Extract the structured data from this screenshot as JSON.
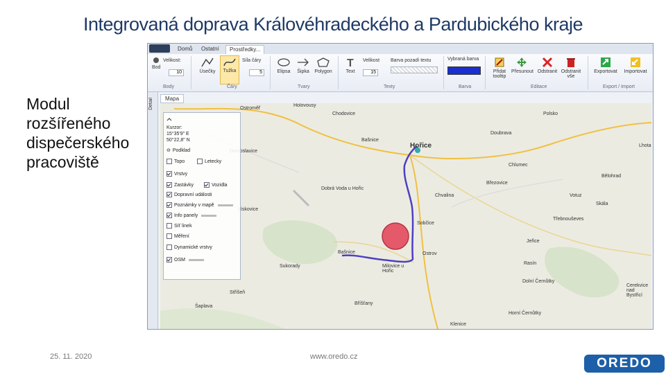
{
  "slide": {
    "title": "Integrovaná doprava Královéhradeckého a Pardubického kraje",
    "side_text": "Modul rozšířeného dispečerského pracoviště",
    "date": "25. 11. 2020",
    "url": "www.oredo.cz",
    "logo": "OREDO"
  },
  "app": {
    "tabs": [
      "Domů",
      "Ostatní",
      "Prostředky..."
    ],
    "ribbon": {
      "buttons": {
        "bod": "Bod",
        "velikost": "Velikost:",
        "usecky": "Úsečky",
        "tuzka": "Tužka",
        "sila_cary": "Síla čáry",
        "elipsa": "Elipsa",
        "sipka": "Šipka",
        "polygon": "Polygon",
        "text": "Text",
        "velikost2": "Velikost",
        "barva_pozadi": "Barva pozadí textu",
        "vybrana_barva": "Vybraná barva",
        "pridat_tooltip": "Přidat tooltip",
        "presunout": "Přesunout",
        "odstranit": "Odstranit",
        "odstranit_vse": "Odstranit vše",
        "exportovat": "Exportovat",
        "importovat": "Importovat"
      },
      "values": {
        "bod_size": "10",
        "sila": "5",
        "text_size": "15"
      },
      "groups": {
        "body": "Body",
        "cary": "Čáry",
        "tvary": "Tvary",
        "texty": "Texty",
        "barva": "Barva",
        "editace": "Editace",
        "export": "Export / Import"
      },
      "colors": {
        "accent": "#1a2fd0"
      }
    },
    "detail_tab": "Detail",
    "map_tab": "Mapa",
    "panel": {
      "kurzor_label": "Kurzor:",
      "lon": "15°35'9\" E",
      "lat": "50°22,8\" N",
      "podklad": "Podklad",
      "layers": [
        {
          "label": "Topo",
          "checked": false
        },
        {
          "label": "Letecky",
          "checked": false
        },
        {
          "label": "Vrstvy",
          "checked": true
        },
        {
          "label": "Zastávky",
          "checked": true
        },
        {
          "label": "Vozidla",
          "checked": true
        },
        {
          "label": "Dopravní události",
          "checked": true
        },
        {
          "label": "Poznámky v mapě",
          "checked": true
        },
        {
          "label": "Info panely",
          "checked": true
        },
        {
          "label": "Síť linek",
          "checked": false
        },
        {
          "label": "Měření",
          "checked": false
        },
        {
          "label": "Dynamické vrstvy",
          "checked": false
        },
        {
          "label": "OSM",
          "checked": true
        }
      ]
    },
    "places": [
      "Ostroměř",
      "Holovousy",
      "Chodovice",
      "Domoslavice",
      "Bašnice",
      "Hořice",
      "Dobrá Voda u Hořic",
      "Chlumec",
      "Březovice",
      "Lhota",
      "Doubrava",
      "Polsko",
      "Bašnice",
      "Sobčice",
      "Ostrov",
      "Dolní Černůtky",
      "Rasín",
      "Třebnouševes",
      "Sukorady",
      "Skála",
      "Bělohrad",
      "Cerekvice nad Bystřicí",
      "Lískovice",
      "Jeřice",
      "Votuz",
      "Milovice u Hořic",
      "Stříšeň",
      "Bříšťany",
      "Horní Černůtky",
      "Klenice",
      "Chvalina",
      "Šaplava"
    ]
  }
}
